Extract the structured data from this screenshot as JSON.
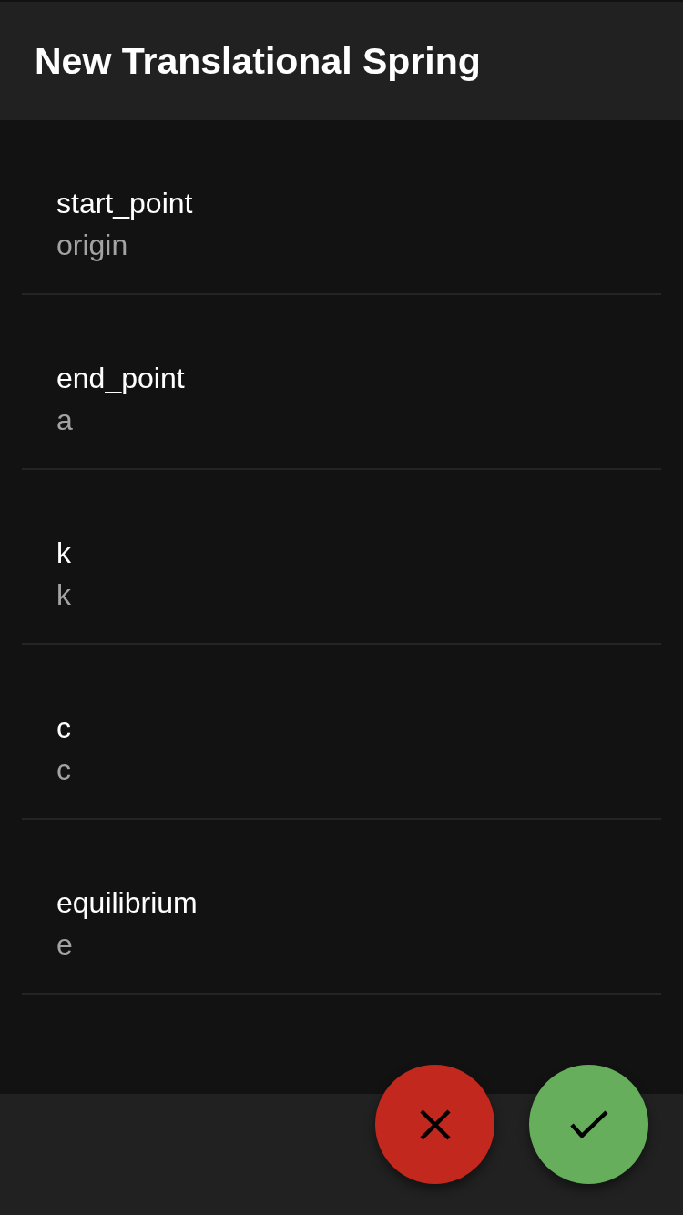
{
  "app_bar": {
    "title": "New Translational Spring"
  },
  "fields": [
    {
      "label": "start_point",
      "value": "origin"
    },
    {
      "label": "end_point",
      "value": "a"
    },
    {
      "label": "k",
      "value": "k"
    },
    {
      "label": "c",
      "value": "c"
    },
    {
      "label": "equilibrium",
      "value": "e"
    }
  ],
  "actions": [
    {
      "kind": "cancel"
    },
    {
      "kind": "confirm"
    }
  ]
}
